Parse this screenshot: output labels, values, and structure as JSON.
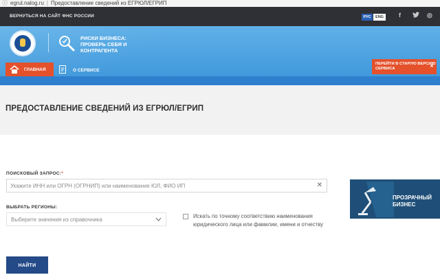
{
  "browser": {
    "url": "egrul.nalog.ru",
    "page_title": "Предоставление сведений из ЕГРЮЛ/ЕГРИП"
  },
  "topbar": {
    "back_link": "ВЕРНУТЬСЯ НА САЙТ ФНС РОССИИ",
    "lang_ru": "РУС",
    "lang_en": "ENG",
    "social": {
      "facebook": "f",
      "twitter": "t",
      "instagram": "◎"
    }
  },
  "header": {
    "tagline": "РИСКИ БИЗНЕСА: ПРОВЕРЬ СЕБЯ И КОНТРАГЕНТА",
    "old_version": "ПЕРЕЙТИ В СТАРУЮ ВЕРСИЮ СЕРВИСА",
    "old_version_close": "✕"
  },
  "nav": {
    "home": "ГЛАВНАЯ",
    "about": "О СЕРВИСЕ"
  },
  "page": {
    "title": "ПРЕДОСТАВЛЕНИЕ СВЕДЕНИЙ ИЗ ЕГРЮЛ/ЕГРИП"
  },
  "form": {
    "search_label": "ПОИСКОВЫЙ ЗАПРОС:",
    "required_mark": "*",
    "search_placeholder": "Укажите ИНН или ОГРН (ОГРНИП) или наименование ЮЛ, ФИО ИП",
    "clear_icon": "✕",
    "region_label": "ВЫБРАТЬ РЕГИОНЫ:",
    "region_placeholder": "Выберите значения из справочника",
    "exact_match_label": "Искать по точному соответствию наименования юридического лица или фамилии, имени и отчеству",
    "submit": "НАЙТИ"
  },
  "promo": {
    "line1": "ПРОЗРАЧНЫЙ",
    "line2": "БИЗНЕС"
  },
  "colors": {
    "accent": "#e4512b",
    "header_blue": "#3c95d9",
    "button_blue": "#244a88",
    "dark_bar": "#2f3035"
  }
}
